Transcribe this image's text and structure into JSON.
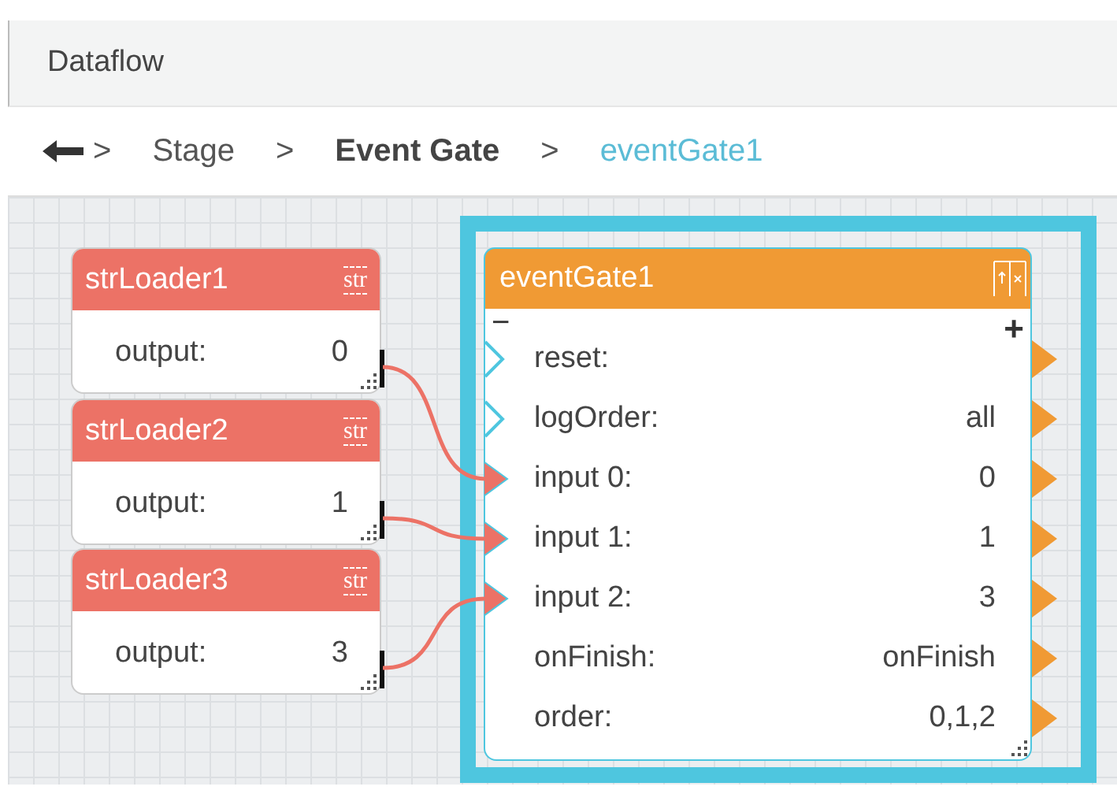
{
  "panel": {
    "title": "Dataflow"
  },
  "breadcrumb": [
    {
      "separator": ">",
      "label": "Stage",
      "kind": "plain"
    },
    {
      "separator": ">",
      "label": "Event Gate",
      "kind": "bold"
    },
    {
      "separator": ">",
      "label": "eventGate1",
      "kind": "current"
    }
  ],
  "loaders": [
    {
      "title": "strLoader1",
      "icon": "str",
      "label": "output:",
      "value": "0"
    },
    {
      "title": "strLoader2",
      "icon": "str",
      "label": "output:",
      "value": "1"
    },
    {
      "title": "strLoader3",
      "icon": "str",
      "label": "output:",
      "value": "3"
    }
  ],
  "gate": {
    "title": "eventGate1",
    "selected": true,
    "collapse": "−",
    "expand": "+",
    "rows": [
      {
        "label": "reset:",
        "kind": "event"
      },
      {
        "label": "logOrder:",
        "value": "all",
        "kind": "event"
      },
      {
        "label": "input 0:",
        "value": "0",
        "kind": "linked"
      },
      {
        "label": "input 1:",
        "value": "1",
        "kind": "linked"
      },
      {
        "label": "input 2:",
        "value": "3",
        "kind": "linked"
      },
      {
        "label": "onFinish:",
        "value": "onFinish",
        "kind": "plain"
      },
      {
        "label": "order:",
        "value": "0,1,2",
        "kind": "plain"
      }
    ]
  }
}
